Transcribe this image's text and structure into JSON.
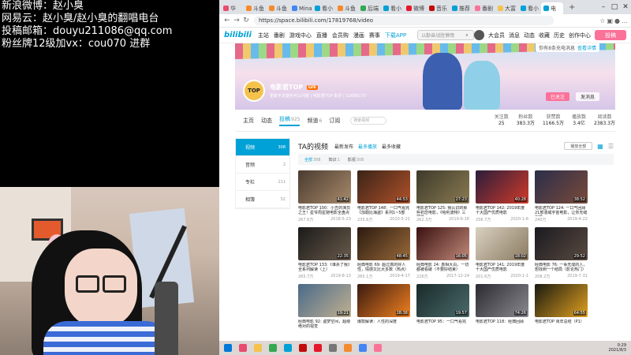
{
  "overlay": {
    "lines": [
      "新浪微博：赵小臭",
      "网易云：赵小臭/赵小臭的翻唱电台",
      "投稿邮箱：douyu211086@qq.com",
      "粉丝牌12级加vx：cou070 进群"
    ]
  },
  "browser": {
    "tabs": [
      {
        "label": "华",
        "color": "#e94b6f"
      },
      {
        "label": "斗鱼",
        "color": "#f58b2c"
      },
      {
        "label": "斗鱼",
        "color": "#f58b2c"
      },
      {
        "label": "Mina",
        "color": "#4285f4"
      },
      {
        "label": "看小",
        "color": "#00a1d6"
      },
      {
        "label": "斗鱼",
        "color": "#f58b2c"
      },
      {
        "label": "后端",
        "color": "#34a853"
      },
      {
        "label": "看小",
        "color": "#00a1d6"
      },
      {
        "label": "微博",
        "color": "#e6162d"
      },
      {
        "label": "音乐",
        "color": "#c20c0c"
      },
      {
        "label": "推荐",
        "color": "#00a1d6"
      },
      {
        "label": "番剧",
        "color": "#fb7299"
      },
      {
        "label": "大富",
        "color": "#f5c24c"
      },
      {
        "label": "看小",
        "color": "#00a1d6"
      },
      {
        "label": "电",
        "color": "#00a1d6"
      }
    ],
    "url": "https://space.bilibili.com/17819768/video"
  },
  "header": {
    "logo": "bilibili",
    "nav": [
      "主站",
      "番剧",
      "游戏中心",
      "直播",
      "会员购",
      "漫画",
      "赛事"
    ],
    "download": "下载APP",
    "search_placeholder": "以勤奋战胜懒惰",
    "right": [
      "大会员",
      "消息",
      "动态",
      "收藏",
      "历史",
      "创作中心"
    ],
    "upload": "投稿"
  },
  "banner": {
    "notice": "你有8条充电消息",
    "notice_link": "查看详情",
    "avatar_text": "TOP",
    "name": "电影君TOP",
    "level": "LV6",
    "sign": "更新不定期也可以问我 | 电影君TOP 影评 | 52686170",
    "follow": "已关注",
    "message": "发消息"
  },
  "profile_tabs": [
    {
      "label": "主页",
      "n": ""
    },
    {
      "label": "动态",
      "n": ""
    },
    {
      "label": "投稿",
      "n": "925"
    },
    {
      "label": "频道",
      "n": "6"
    },
    {
      "label": "订阅",
      "n": ""
    }
  ],
  "tab_search": "搜索视频",
  "stats": [
    {
      "k": "关注数",
      "v": "25"
    },
    {
      "k": "粉丝数",
      "v": "383.3万"
    },
    {
      "k": "获赞数",
      "v": "1166.5万"
    },
    {
      "k": "播放数",
      "v": "3.4亿"
    },
    {
      "k": "阅读数",
      "v": "2383.3万"
    }
  ],
  "leftnav": [
    {
      "label": "视频",
      "n": "308"
    },
    {
      "label": "音频",
      "n": "2"
    },
    {
      "label": "专栏",
      "n": "211"
    },
    {
      "label": "相簿",
      "n": "52"
    }
  ],
  "videos_panel": {
    "title": "TA的视频",
    "orders": [
      "最新发布",
      "最多播放",
      "最多收藏"
    ],
    "play_all": "播放全部",
    "filters": [
      {
        "label": "全部",
        "n": "308"
      },
      {
        "label": "知识",
        "n": "1"
      },
      {
        "label": "影视",
        "n": "308"
      }
    ]
  },
  "videos": [
    {
      "title": "电影君TOP 100：小丑的演员之王！星爷周星驰电影全盘点",
      "views": "267.6万",
      "date": "2018-5-23",
      "dur": "41:42",
      "c1": "#4a3b30",
      "c2": "#a88a6a"
    },
    {
      "title": "电影君TOP 148：一口气看完《加勒比海盗》系列1~5部",
      "views": "235.6万",
      "date": "2020-5-21",
      "dur": "44:53",
      "c1": "#3a2418",
      "c2": "#b0512a"
    },
    {
      "title": "电影君TOP 125: 我认识的那些初恋电影，《哈利波特》三部曲",
      "views": "262.3万",
      "date": "2019-6-18",
      "dur": "27:23",
      "c1": "#3d3a2a",
      "c2": "#8a7a52"
    },
    {
      "title": "电影君TOP 142: 2019年度十大国产优质电影",
      "views": "256.7万",
      "date": "2020-1-8",
      "dur": "40:28",
      "c1": "#2a1e3b",
      "c2": "#d03a2a"
    },
    {
      "title": "电影君TOP 124: 一口气回顾21部漫威宇宙电影，让你无缝衔接",
      "views": "240万",
      "date": "2019-4-22",
      "dur": "38:52",
      "c1": "#2a2e4a",
      "c2": "#7a4a3a"
    },
    {
      "title": "电影君TOP 133:《谁杀了我》全系列解读（上）",
      "views": "265.7万",
      "date": "2019-8-13",
      "dur": "22:35",
      "c1": "#1a1a1a",
      "c2": "#6a5a4a"
    },
    {
      "title": "经典电影 69: 超过真的好人性，情感又比大多数（热点）",
      "views": "265.1万",
      "date": "2019-4-17",
      "dur": "48:45",
      "c1": "#2a1a10",
      "c2": "#9a6a3a"
    },
    {
      "title": "经典电影 24: 真相大白，一切都被看破（不要好结束）",
      "views": "226万",
      "date": "2017-12-24",
      "dur": "16:05",
      "c1": "#3a1010",
      "c2": "#c28a7a"
    },
    {
      "title": "电影君TOP 141: 2019年度十大国产优质电影",
      "views": "201.6万",
      "date": "2020-1-1",
      "dur": "18:02",
      "c1": "#d8d0c0",
      "c2": "#8a7a60"
    },
    {
      "title": "经典电影 76: 一事无成的人，想找到一个结局（影论热门）",
      "views": "208.2万",
      "date": "2019-7-31",
      "dur": "29:52",
      "c1": "#1a1a20",
      "c2": "#5a4a40"
    },
    {
      "title": "经典电影 92: 盗梦空间，超级绝对的视觉",
      "views": "",
      "date": "",
      "dur": "19:21",
      "c1": "#4a6a8a",
      "c2": "#c0b090"
    },
    {
      "title": "爆款解读：人性的深度",
      "views": "",
      "date": "",
      "dur": "28:38",
      "c1": "#3a1a10",
      "c2": "#f08020"
    },
    {
      "title": "电影君TOP 95：一口气看完",
      "views": "",
      "date": "",
      "dur": "19:57",
      "c1": "#1a2a2a",
      "c2": "#4a6a6a"
    },
    {
      "title": "电影君TOP 118：经典回顾",
      "views": "",
      "date": "",
      "dur": "74:26",
      "c1": "#2a2a30",
      "c2": "#8a8a90"
    },
    {
      "title": "电影君TOP 周年总结（P1）",
      "views": "",
      "date": "",
      "dur": "64:55",
      "c1": "#1a1a10",
      "c2": "#e0a020"
    }
  ],
  "taskbar": {
    "icons": [
      "#0078d7",
      "#e94b6f",
      "#f5c24c",
      "#34a853",
      "#00a1d6",
      "#c20c0c",
      "#e6162d",
      "#777777",
      "#f58b2c",
      "#4285f4",
      "#fb7299"
    ],
    "time": "0:29",
    "date": "2021/8/3"
  }
}
